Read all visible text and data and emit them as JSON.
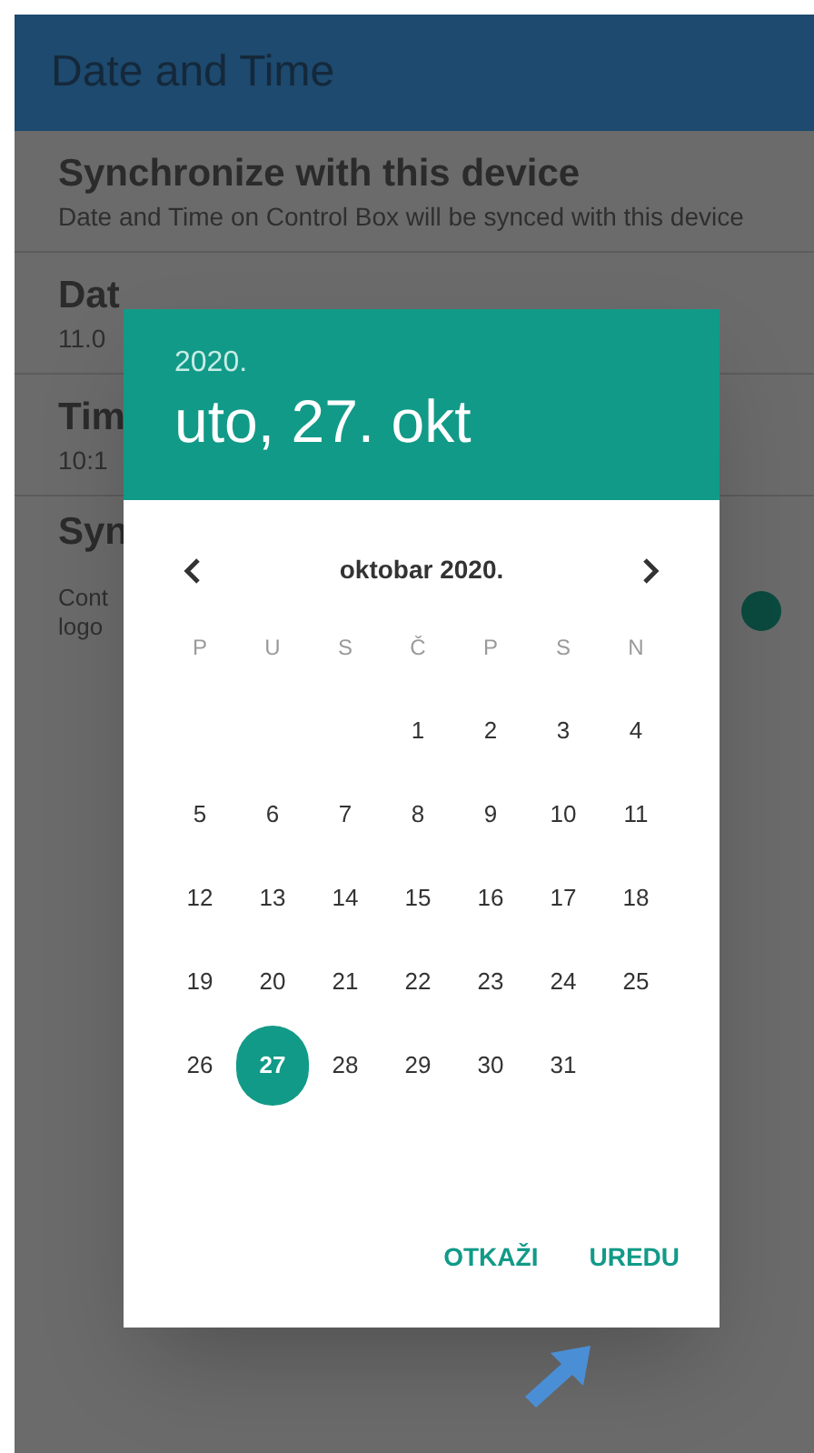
{
  "app_bar": {
    "title": "Date and Time"
  },
  "settings": [
    {
      "kind": "text",
      "title": "Synchronize with this device",
      "subtitle": "Date and Time on Control Box will be synced with this device"
    },
    {
      "kind": "text",
      "title": "Dat",
      "subtitle": "11.0"
    },
    {
      "kind": "text",
      "title": "Tim",
      "subtitle": "10:1"
    },
    {
      "kind": "switch",
      "title": "Syn",
      "subtitle_lines": [
        "Cont",
        "logo"
      ],
      "on": true
    }
  ],
  "date_picker": {
    "year": "2020.",
    "date": "uto, 27. okt",
    "month": "oktobar 2020.",
    "weekdays": [
      "P",
      "U",
      "S",
      "Č",
      "P",
      "S",
      "N"
    ],
    "weeks": [
      {
        "kind": "partial_start",
        "days": [
          {
            "label": "1",
            "selected": false
          },
          {
            "label": "2",
            "selected": false
          },
          {
            "label": "3",
            "selected": false
          },
          {
            "label": "4",
            "selected": false
          }
        ]
      },
      {
        "kind": "full",
        "days": [
          {
            "label": "5",
            "selected": false
          },
          {
            "label": "6",
            "selected": false
          },
          {
            "label": "7",
            "selected": false
          },
          {
            "label": "8",
            "selected": false
          },
          {
            "label": "9",
            "selected": false
          },
          {
            "label": "10",
            "selected": false
          },
          {
            "label": "11",
            "selected": false
          }
        ]
      },
      {
        "kind": "full",
        "days": [
          {
            "label": "12",
            "selected": false
          },
          {
            "label": "13",
            "selected": false
          },
          {
            "label": "14",
            "selected": false
          },
          {
            "label": "15",
            "selected": false
          },
          {
            "label": "16",
            "selected": false
          },
          {
            "label": "17",
            "selected": false
          },
          {
            "label": "18",
            "selected": false
          }
        ]
      },
      {
        "kind": "full",
        "days": [
          {
            "label": "19",
            "selected": false
          },
          {
            "label": "20",
            "selected": false
          },
          {
            "label": "21",
            "selected": false
          },
          {
            "label": "22",
            "selected": false
          },
          {
            "label": "23",
            "selected": false
          },
          {
            "label": "24",
            "selected": false
          },
          {
            "label": "25",
            "selected": false
          }
        ]
      },
      {
        "kind": "partial_end",
        "days": [
          {
            "label": "26",
            "selected": false
          },
          {
            "label": "27",
            "selected": true
          },
          {
            "label": "28",
            "selected": false
          },
          {
            "label": "29",
            "selected": false
          },
          {
            "label": "30",
            "selected": false
          },
          {
            "label": "31",
            "selected": false
          }
        ]
      }
    ],
    "buttons": [
      "OTKAŽI",
      "UREDU"
    ]
  }
}
